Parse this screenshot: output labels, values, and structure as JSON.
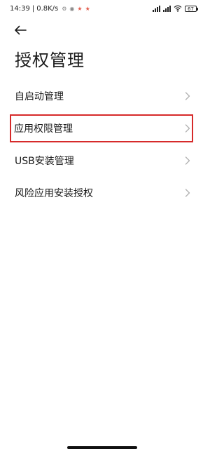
{
  "status_bar": {
    "time": "14:39",
    "separator": "|",
    "network_speed": "0.8K/s",
    "battery_level": "67",
    "icons": [
      "signal-icon",
      "signal-icon",
      "wifi-icon",
      "battery-icon"
    ]
  },
  "header": {
    "back_icon": "arrow-left-icon",
    "title": "授权管理"
  },
  "menu": {
    "items": [
      {
        "label": "自启动管理",
        "icon": "chevron-right-icon",
        "highlighted": false
      },
      {
        "label": "应用权限管理",
        "icon": "chevron-right-icon",
        "highlighted": true
      },
      {
        "label": "USB安装管理",
        "icon": "chevron-right-icon",
        "highlighted": false
      },
      {
        "label": "风险应用安装授权",
        "icon": "chevron-right-icon",
        "highlighted": false
      }
    ]
  },
  "colors": {
    "background": "#ffffff",
    "text": "#1a1a1a",
    "chevron": "#b0b0b0",
    "highlight_border": "#d62a2a"
  }
}
